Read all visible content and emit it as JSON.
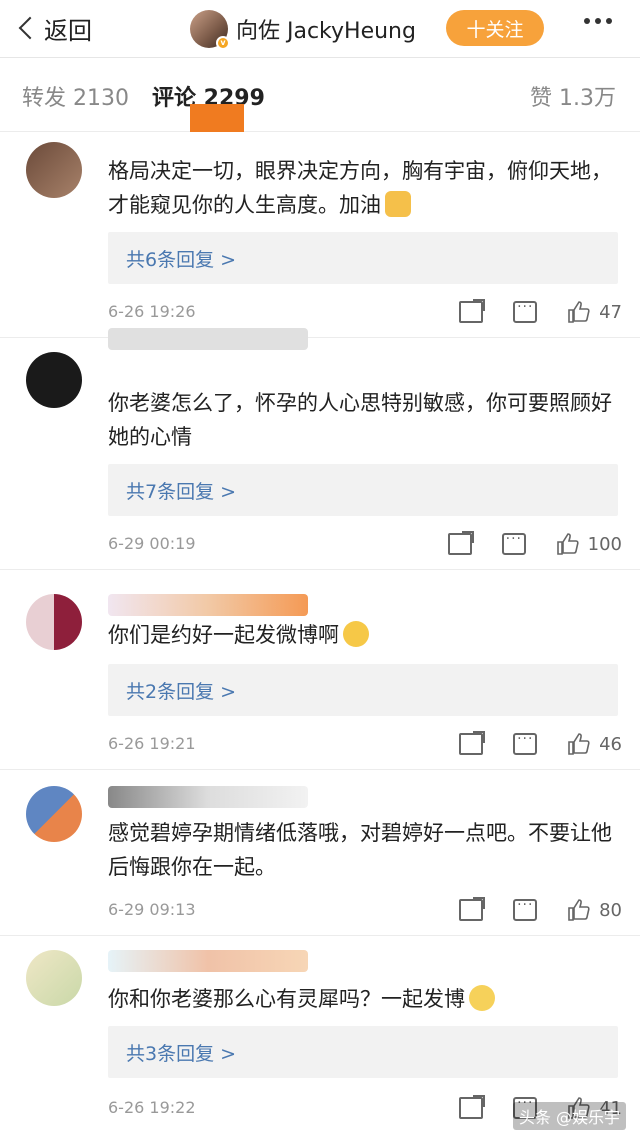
{
  "nav": {
    "back_label": "返回",
    "username": "向佐 JackyHeung",
    "follow_label": "十关注"
  },
  "tabs": {
    "repost": "转发 2130",
    "comments": "评论 2299",
    "likes": "赞 1.3万"
  },
  "comments": [
    {
      "text": "格局决定一切，眼界决定方向，胸有宇宙，俯仰天地，才能窥见你的人生高度。加油",
      "replies": "共6条回复 >",
      "time": "6-26 19:26",
      "likes": "47"
    },
    {
      "text": "你老婆怎么了，怀孕的人心思特别敏感，你可要照顾好她的心情",
      "replies": "共7条回复 >",
      "time": "6-29 00:19",
      "likes": "100"
    },
    {
      "text": "你们是约好一起发微博啊",
      "replies": "共2条回复 >",
      "time": "6-26 19:21",
      "likes": "46"
    },
    {
      "text": "感觉碧婷孕期情绪低落哦，对碧婷好一点吧。不要让他后悔跟你在一起。",
      "time": "6-29 09:13",
      "likes": "80"
    },
    {
      "text": "你和你老婆那么心有灵犀吗？一起发博",
      "replies": "共3条回复 >",
      "time": "6-26 19:22",
      "likes": "41"
    }
  ],
  "watermark": "头条 @娱乐宇",
  "colors": {
    "follow": "#f7a23b",
    "link": "#4a78b0",
    "tab_indicator": "#f07b20"
  }
}
